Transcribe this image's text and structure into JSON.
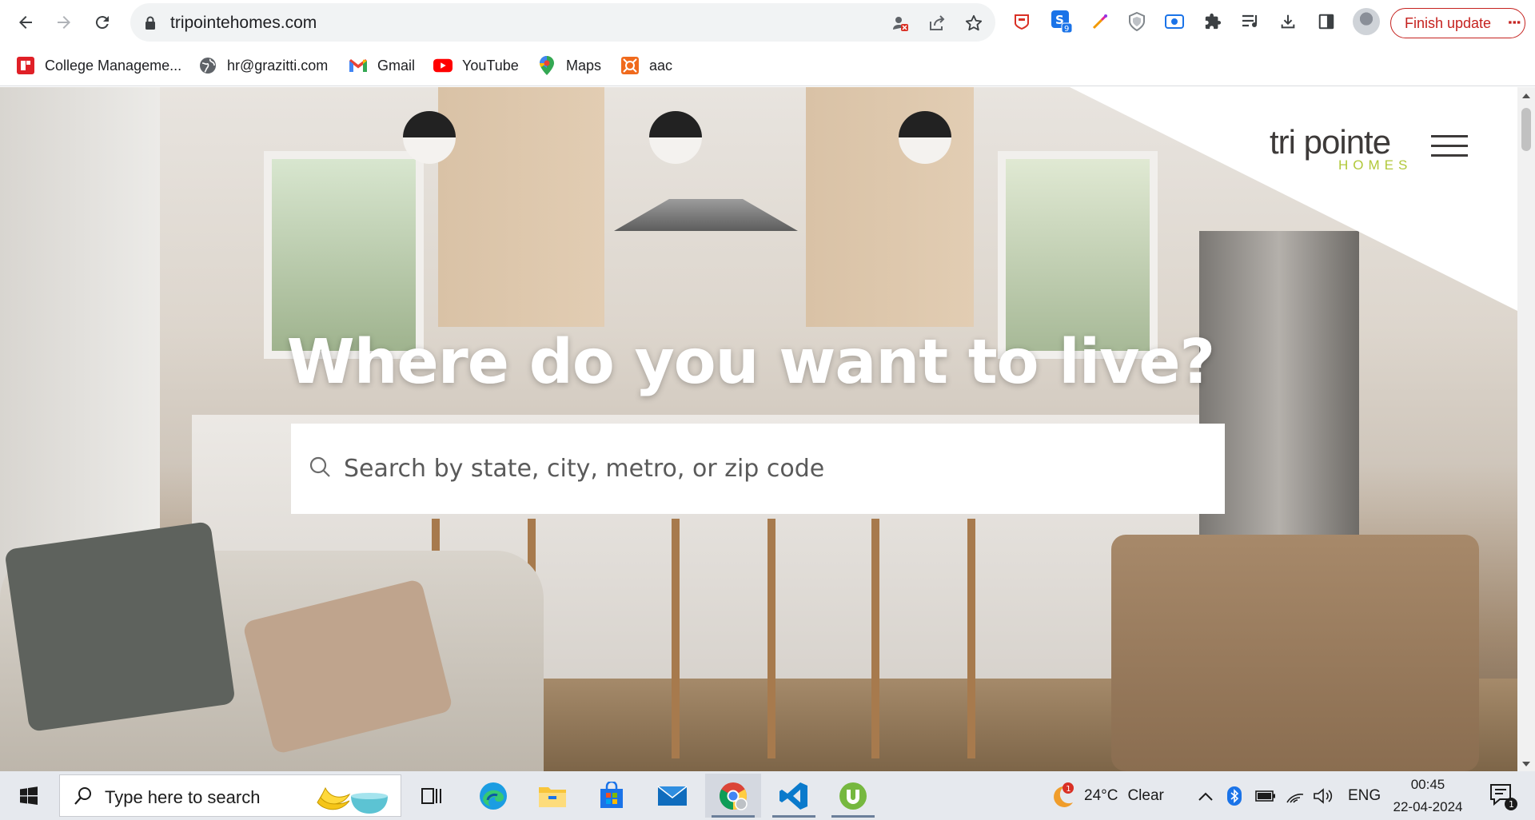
{
  "browser": {
    "url": "tripointehomes.com",
    "finish_update_label": "Finish update",
    "extension_badge": "9"
  },
  "bookmarks": [
    {
      "label": "College Manageme...",
      "icon": "college-icon"
    },
    {
      "label": "hr@grazitti.com",
      "icon": "globe-icon"
    },
    {
      "label": "Gmail",
      "icon": "gmail-icon"
    },
    {
      "label": "YouTube",
      "icon": "youtube-icon"
    },
    {
      "label": "Maps",
      "icon": "maps-icon"
    },
    {
      "label": "aac",
      "icon": "aac-icon"
    }
  ],
  "page": {
    "logo_main": "tri pointe",
    "logo_sub": "HOMES",
    "headline": "Where do you want to live?",
    "search_placeholder": "Search by state, city, metro, or zip code",
    "colors": {
      "logo_green": "#b1c83a",
      "logo_text": "#3d3a39"
    }
  },
  "taskbar": {
    "search_text": "Type here to search",
    "weather_temp": "24°C",
    "weather_cond": "Clear",
    "weather_badge": "1",
    "language": "ENG",
    "time": "00:45",
    "date": "22-04-2024",
    "notification_count": "1",
    "apps": [
      "task-view",
      "edge",
      "file-explorer",
      "microsoft-store",
      "mail",
      "chrome",
      "vscode",
      "utorrent"
    ]
  }
}
